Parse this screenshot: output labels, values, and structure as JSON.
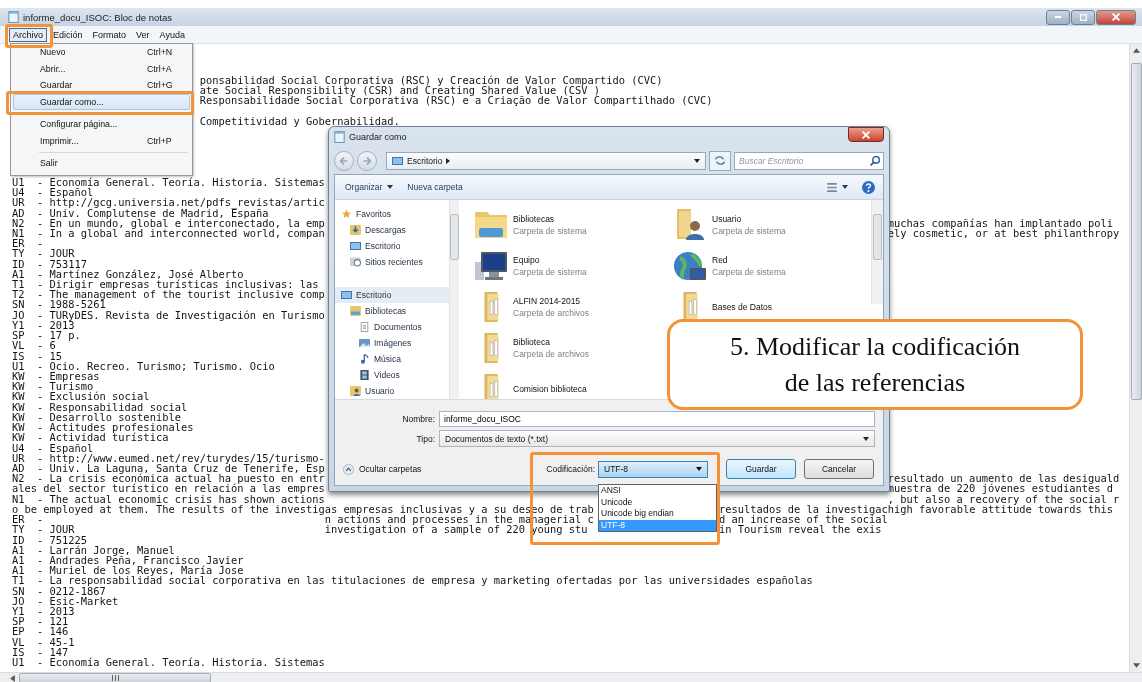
{
  "window": {
    "title": "informe_docu_ISOC: Bloc de notas"
  },
  "menu_bar": [
    {
      "label": "Archivo",
      "selected": true
    },
    {
      "label": "Edición",
      "selected": false
    },
    {
      "label": "Formato",
      "selected": false
    },
    {
      "label": "Ver",
      "selected": false
    },
    {
      "label": "Ayuda",
      "selected": false
    }
  ],
  "file_menu": [
    {
      "kind": "item",
      "label": "Nuevo",
      "shortcut": "Ctrl+N",
      "selected": false
    },
    {
      "kind": "item",
      "label": "Abrir...",
      "shortcut": "Ctrl+A",
      "selected": false
    },
    {
      "kind": "item",
      "label": "Guardar",
      "shortcut": "Ctrl+G",
      "selected": false
    },
    {
      "kind": "item",
      "label": "Guardar como...",
      "selected": true
    },
    {
      "kind": "separator"
    },
    {
      "kind": "item",
      "label": "Configurar página...",
      "selected": false
    },
    {
      "kind": "item",
      "label": "Imprimir...",
      "shortcut": "Ctrl+P",
      "selected": false
    },
    {
      "kind": "separator"
    },
    {
      "kind": "item",
      "label": "Salir",
      "selected": false
    }
  ],
  "document": {
    "lines": [
      {
        "kind": "blank"
      },
      {
        "kind": "blank"
      },
      {
        "kind": "blank"
      },
      {
        "kind": "text",
        "parts": [
          {
            "kind": "after_menu",
            "text": "ponsabilidad Social Corporativa (RSC) y Creación de Valor Compartido (CVC)"
          }
        ]
      },
      {
        "kind": "text",
        "parts": [
          {
            "kind": "after_menu",
            "text": "ate Social Responsibility (CSR) and Creating Shared Value (CSV )"
          }
        ]
      },
      {
        "kind": "text",
        "parts": [
          {
            "kind": "after_menu",
            "text": "Responsabilidade Social Corporativa (RSC) e a Criação de Valor Compartilhado (CVC)"
          }
        ]
      },
      {
        "kind": "blank"
      },
      {
        "kind": "text",
        "parts": [
          {
            "kind": "after_menu",
            "text": "Competitividad y Gobernabilidad."
          }
        ]
      },
      {
        "kind": "blank"
      },
      {
        "kind": "blank"
      },
      {
        "kind": "blank"
      },
      {
        "kind": "blank"
      },
      {
        "kind": "blank"
      },
      {
        "kind": "text",
        "parts": [
          {
            "kind": "left",
            "text": "U1  - Economía General. Teoría. Historia. Sistemas"
          }
        ]
      },
      {
        "kind": "text",
        "parts": [
          {
            "kind": "left",
            "text": "U4  - Español"
          }
        ]
      },
      {
        "kind": "text",
        "parts": [
          {
            "kind": "left",
            "text": "UR  - http://gcg.universia.net/pdfs_revistas/artic"
          }
        ]
      },
      {
        "kind": "text",
        "parts": [
          {
            "kind": "left",
            "text": "AD  - Univ. Complutense de Madrid, España"
          }
        ]
      },
      {
        "kind": "text",
        "parts": [
          {
            "kind": "left",
            "text": "N2  - En un mundo, global e interconectado, la emp"
          },
          {
            "kind": "right",
            "text": "muchas compañías han implantado poli"
          }
        ]
      },
      {
        "kind": "text",
        "parts": [
          {
            "kind": "left",
            "text": "N1  - In a global and interconnected world, compan"
          },
          {
            "kind": "right",
            "text": "ely cosmetic, or at best philanthropy"
          }
        ]
      },
      {
        "kind": "text",
        "parts": [
          {
            "kind": "left",
            "text": "ER  -"
          }
        ]
      },
      {
        "kind": "text",
        "parts": [
          {
            "kind": "left",
            "text": "TY  - JOUR"
          }
        ]
      },
      {
        "kind": "text",
        "parts": [
          {
            "kind": "left",
            "text": "ID  - 753117"
          }
        ]
      },
      {
        "kind": "text",
        "parts": [
          {
            "kind": "left",
            "text": "A1  - Martínez González, José Alberto"
          }
        ]
      },
      {
        "kind": "text",
        "parts": [
          {
            "kind": "left",
            "text": "T1  - Dirigir empresas turísticas inclusivas: las"
          }
        ]
      },
      {
        "kind": "text",
        "parts": [
          {
            "kind": "left",
            "text": "T2  - The management of the tourist inclusive comp"
          }
        ]
      },
      {
        "kind": "text",
        "parts": [
          {
            "kind": "left",
            "text": "SN  - 1988-5261"
          }
        ]
      },
      {
        "kind": "text",
        "parts": [
          {
            "kind": "left",
            "text": "JO  - TURyDES. Revista de Investigación en Turismo"
          }
        ]
      },
      {
        "kind": "text",
        "parts": [
          {
            "kind": "left",
            "text": "Y1  - 2013"
          }
        ]
      },
      {
        "kind": "text",
        "parts": [
          {
            "kind": "left",
            "text": "SP  - 17 p."
          }
        ]
      },
      {
        "kind": "text",
        "parts": [
          {
            "kind": "left",
            "text": "VL  - 6"
          }
        ]
      },
      {
        "kind": "text",
        "parts": [
          {
            "kind": "left",
            "text": "IS  - 15"
          }
        ]
      },
      {
        "kind": "text",
        "parts": [
          {
            "kind": "left",
            "text": "U1  - Ocio. Recreo. Turismo; Turismo. Ocio"
          }
        ]
      },
      {
        "kind": "text",
        "parts": [
          {
            "kind": "left",
            "text": "KW  - Empresas"
          }
        ]
      },
      {
        "kind": "text",
        "parts": [
          {
            "kind": "left",
            "text": "KW  - Turismo"
          }
        ]
      },
      {
        "kind": "text",
        "parts": [
          {
            "kind": "left",
            "text": "KW  - Exclusión social"
          }
        ]
      },
      {
        "kind": "text",
        "parts": [
          {
            "kind": "left",
            "text": "KW  - Responsabilidad social"
          }
        ]
      },
      {
        "kind": "text",
        "parts": [
          {
            "kind": "left",
            "text": "KW  - Desarrollo sostenible"
          }
        ]
      },
      {
        "kind": "text",
        "parts": [
          {
            "kind": "left",
            "text": "KW  - Actitudes profesionales"
          }
        ]
      },
      {
        "kind": "text",
        "parts": [
          {
            "kind": "left",
            "text": "KW  - Actividad turística"
          }
        ]
      },
      {
        "kind": "text",
        "parts": [
          {
            "kind": "left",
            "text": "U4  - Español"
          }
        ]
      },
      {
        "kind": "text",
        "parts": [
          {
            "kind": "left",
            "text": "UR  - http://www.eumed.net/rev/turydes/15/turismo-"
          }
        ]
      },
      {
        "kind": "text",
        "parts": [
          {
            "kind": "left",
            "text": "AD  - Univ. La Laguna, Santa Cruz de Tenerife, Esp"
          }
        ]
      },
      {
        "kind": "text",
        "parts": [
          {
            "kind": "left",
            "text": "N2  - La crisis económica actual ha puesto en entr"
          },
          {
            "kind": "right",
            "text": "resultado un aumento de las desiguald"
          }
        ]
      },
      {
        "kind": "text",
        "parts": [
          {
            "kind": "left",
            "text": "ales del sector turístico en relación a las empres"
          },
          {
            "kind": "right",
            "text": "muestra de 220 jóvenes estudiantes d"
          }
        ]
      },
      {
        "kind": "text",
        "parts": [
          {
            "kind": "left",
            "text": "N1  - The actual economic crisis has shown actions"
          },
          {
            "kind": "right",
            "text": ", but also a recovery of the social r"
          }
        ]
      },
      {
        "kind": "text",
        "parts": [
          {
            "kind": "left",
            "text": "o be employed at them. The results of the investig"
          },
          {
            "kind": "under_dialog",
            "text": "as empresas inclusivas y a su deseo de trab"
          },
          {
            "kind": "beside_list",
            "text": "resultados de la investigac"
          },
          {
            "kind": "right",
            "text": "high favorable attitude towards this"
          }
        ]
      },
      {
        "kind": "text",
        "parts": [
          {
            "kind": "left",
            "text": "ER  -"
          },
          {
            "kind": "under_dialog",
            "text": "n actions and processes in the managerial c"
          },
          {
            "kind": "beside_list",
            "text": "d an increase of the social"
          }
        ]
      },
      {
        "kind": "text",
        "parts": [
          {
            "kind": "left",
            "text": "TY  - JOUR"
          },
          {
            "kind": "under_dialog",
            "text": "investigation of a sample of 220 young stu"
          },
          {
            "kind": "beside_list",
            "text": "in Tourism reveal the exis"
          }
        ]
      },
      {
        "kind": "text",
        "parts": [
          {
            "kind": "left",
            "text": "ID  - 751225"
          }
        ]
      },
      {
        "kind": "text",
        "parts": [
          {
            "kind": "left",
            "text": "A1  - Larrán Jorge, Manuel"
          }
        ]
      },
      {
        "kind": "text",
        "parts": [
          {
            "kind": "left",
            "text": "A1  - Andrades Peña, Francisco Javier"
          }
        ]
      },
      {
        "kind": "text",
        "parts": [
          {
            "kind": "left",
            "text": "A1  - Muriel de los Reyes, María Jose"
          }
        ]
      },
      {
        "kind": "text",
        "parts": [
          {
            "kind": "left",
            "text": "T1  - La responsabilidad social corporativa en las titulaciones de empresa y marketing ofertadas por las universidades españolas"
          }
        ]
      },
      {
        "kind": "text",
        "parts": [
          {
            "kind": "left",
            "text": "SN  - 0212-1867"
          }
        ]
      },
      {
        "kind": "text",
        "parts": [
          {
            "kind": "left",
            "text": "JO  - Esic-Market"
          }
        ]
      },
      {
        "kind": "text",
        "parts": [
          {
            "kind": "left",
            "text": "Y1  - 2013"
          }
        ]
      },
      {
        "kind": "text",
        "parts": [
          {
            "kind": "left",
            "text": "SP  - 121"
          }
        ]
      },
      {
        "kind": "text",
        "parts": [
          {
            "kind": "left",
            "text": "EP  - 146"
          }
        ]
      },
      {
        "kind": "text",
        "parts": [
          {
            "kind": "left",
            "text": "VL  - 45-1"
          }
        ]
      },
      {
        "kind": "text",
        "parts": [
          {
            "kind": "left",
            "text": "IS  - 147"
          }
        ]
      },
      {
        "kind": "text",
        "parts": [
          {
            "kind": "left",
            "text": "U1  - Economía General. Teoría. Historia. Sistemas"
          }
        ]
      }
    ]
  },
  "save_dialog": {
    "title": "Guardar como",
    "location": "Escritorio",
    "search": {
      "placeholder": "Buscar Escritorio"
    },
    "toolbar": [
      {
        "label": "Organizar",
        "dropdown": true
      },
      {
        "label": "Nueva carpeta",
        "dropdown": false
      }
    ],
    "nav": [
      {
        "label": "Favoritos",
        "kind": "star",
        "selected": false,
        "children": [
          {
            "label": "Descargas",
            "kind": "download",
            "selected": false
          },
          {
            "label": "Escritorio",
            "kind": "desktop",
            "selected": false
          },
          {
            "label": "Sitios recientes",
            "kind": "recent",
            "selected": false
          }
        ]
      },
      {
        "label": "Escritorio",
        "kind": "desktop",
        "selected": true,
        "children": [
          {
            "label": "Bibliotecas",
            "kind": "library",
            "selected": false,
            "children": [
              {
                "label": "Documentos",
                "kind": "document",
                "selected": false
              },
              {
                "label": "Imágenes",
                "kind": "pictures",
                "selected": false
              },
              {
                "label": "Música",
                "kind": "music",
                "selected": false
              },
              {
                "label": "Videos",
                "kind": "video",
                "selected": false
              }
            ]
          },
          {
            "label": "Usuario",
            "kind": "user",
            "selected": false
          }
        ]
      }
    ],
    "items": [
      {
        "name": "Bibliotecas",
        "type": "Carpeta de sistema",
        "kind": "library"
      },
      {
        "name": "Equipo",
        "type": "Carpeta de sistema",
        "kind": "computer"
      },
      {
        "name": "ALFIN 2014-2015",
        "type": "Carpeta de archivos",
        "kind": "folder"
      },
      {
        "name": "Biblioteca",
        "type": "Carpeta de archivos",
        "kind": "folder"
      },
      {
        "name": "Comision biblioteca",
        "kind": "folder"
      },
      {
        "name": "Usuario",
        "type": "Carpeta de sistema",
        "kind": "user"
      },
      {
        "name": "Red",
        "type": "Carpeta de sistema",
        "kind": "network"
      },
      {
        "name": "Bases de Datos",
        "kind": "folder"
      }
    ],
    "file_name": {
      "label": "Nombre:",
      "value": "informe_docu_ISOC"
    },
    "file_type": {
      "label": "Tipo:",
      "value": "Documentos de texto (*.txt)"
    },
    "hide_folders": "Ocultar carpetas",
    "encoding": {
      "label": "Codificación:",
      "value": "UTF-8",
      "options": [
        {
          "label": "ANSI",
          "selected": false
        },
        {
          "label": "Unicode",
          "selected": false
        },
        {
          "label": "Unicode big endian",
          "selected": false
        },
        {
          "label": "UTF-8",
          "selected": true
        }
      ]
    },
    "buttons": [
      {
        "label": "Guardar",
        "default": true
      },
      {
        "label": "Cancelar",
        "default": false
      }
    ]
  },
  "callout": {
    "lines": [
      "5. Modificar la codificación",
      "de las referencias"
    ]
  }
}
